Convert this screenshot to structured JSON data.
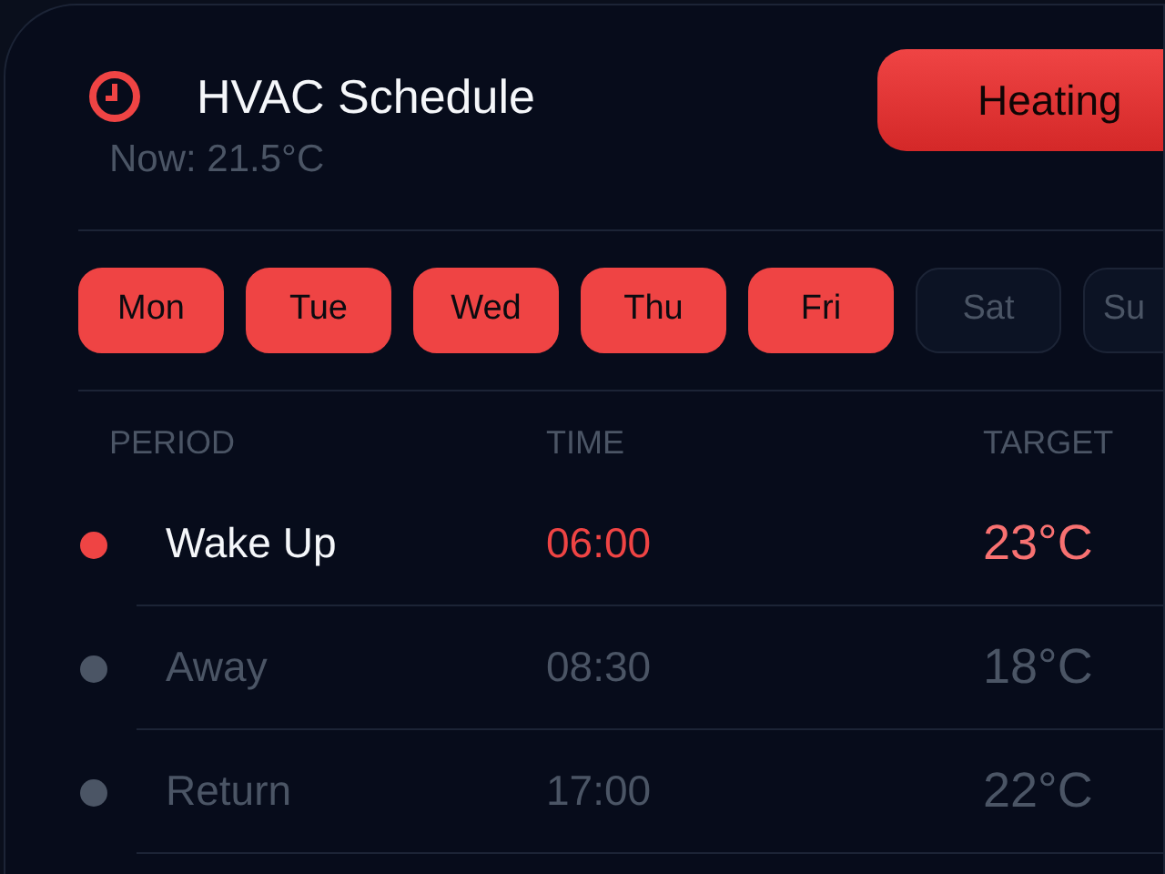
{
  "header": {
    "title": "HVAC Schedule",
    "now": "Now: 21.5°C",
    "mode_button": "Heating"
  },
  "days": [
    {
      "label": "Mon",
      "selected": true
    },
    {
      "label": "Tue",
      "selected": true
    },
    {
      "label": "Wed",
      "selected": true
    },
    {
      "label": "Thu",
      "selected": true
    },
    {
      "label": "Fri",
      "selected": true
    },
    {
      "label": "Sat",
      "selected": false
    },
    {
      "label": "Su",
      "selected": false
    }
  ],
  "table": {
    "columns": [
      "PERIOD",
      "TIME",
      "TARGET"
    ],
    "rows": [
      {
        "period": "Wake Up",
        "time": "06:00",
        "target": "23°C",
        "selected": true
      },
      {
        "period": "Away",
        "time": "08:30",
        "target": "18°C",
        "selected": false
      },
      {
        "period": "Return",
        "time": "17:00",
        "target": "22°C",
        "selected": false
      }
    ]
  }
}
